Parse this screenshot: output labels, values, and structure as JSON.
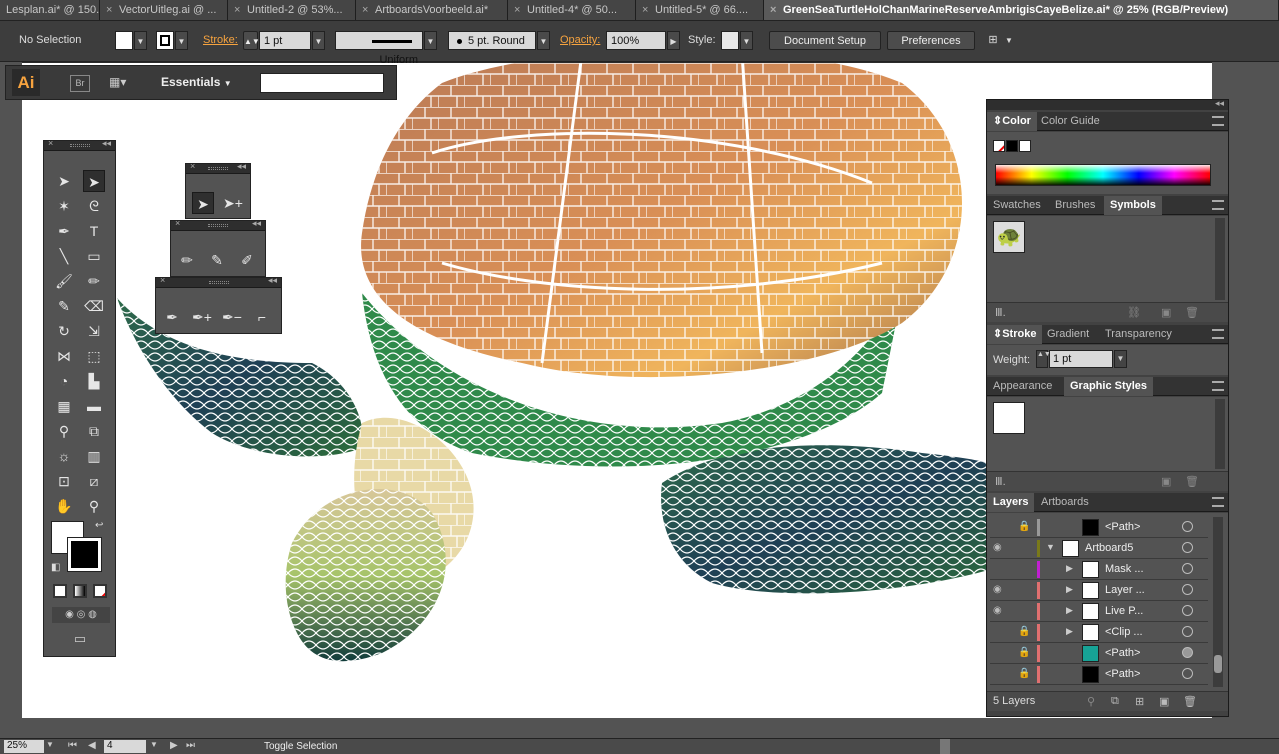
{
  "tabs": [
    {
      "label": "Lesplan.ai* @ 150..."
    },
    {
      "label": "VectorUitleg.ai @ ..."
    },
    {
      "label": "Untitled-2 @ 53%..."
    },
    {
      "label": "ArtboardsVoorbeeld.ai*"
    },
    {
      "label": "Untitled-4* @ 50..."
    },
    {
      "label": "Untitled-5* @ 66...."
    },
    {
      "label": "GreenSeaTurtleHolChanMarineReserveAmbrigisCayeBelize.ai* @ 25% (RGB/Preview)"
    }
  ],
  "control": {
    "selection": "No Selection",
    "stroke_label": "Stroke:",
    "stroke_weight": "1 pt",
    "stroke_profile": "Uniform",
    "brush": "5 pt. Round",
    "opacity_label": "Opacity:",
    "opacity": "100%",
    "style_label": "Style:",
    "document_setup": "Document Setup",
    "preferences": "Preferences"
  },
  "appbar": {
    "logo": "Ai",
    "bridge": "Br",
    "workspace": "Essentials",
    "search_placeholder": ""
  },
  "dock": {
    "color_tabs": [
      "Color",
      "Color Guide"
    ],
    "swatch_tabs": [
      "Swatches",
      "Brushes",
      "Symbols"
    ],
    "stroke_tabs": [
      "Stroke",
      "Gradient",
      "Transparency"
    ],
    "weight_label": "Weight:",
    "weight_value": "1 pt",
    "appearance_tabs": [
      "Appearance",
      "Graphic Styles"
    ],
    "layers_tabs": [
      "Layers",
      "Artboards"
    ],
    "layers": [
      {
        "name": "<Path>",
        "color": "#999999"
      },
      {
        "name": "Artboard5",
        "color": "#7a7a1a"
      },
      {
        "name": "Mask ...",
        "color": "#c21fd1"
      },
      {
        "name": "Layer ...",
        "color": "#e07070"
      },
      {
        "name": "Live P...",
        "color": "#e07070"
      },
      {
        "name": "<Clip ...",
        "color": "#e07070"
      },
      {
        "name": "<Path>",
        "color": "#e07070"
      },
      {
        "name": "<Path>",
        "color": "#e07070"
      }
    ],
    "layers_count": "5 Layers"
  },
  "status": {
    "zoom": "25%",
    "artboard": "4",
    "mode": "Toggle Selection"
  },
  "colors": {
    "accent": "#f6a33f",
    "panel": "#535353",
    "canvas": "#ffffff"
  }
}
